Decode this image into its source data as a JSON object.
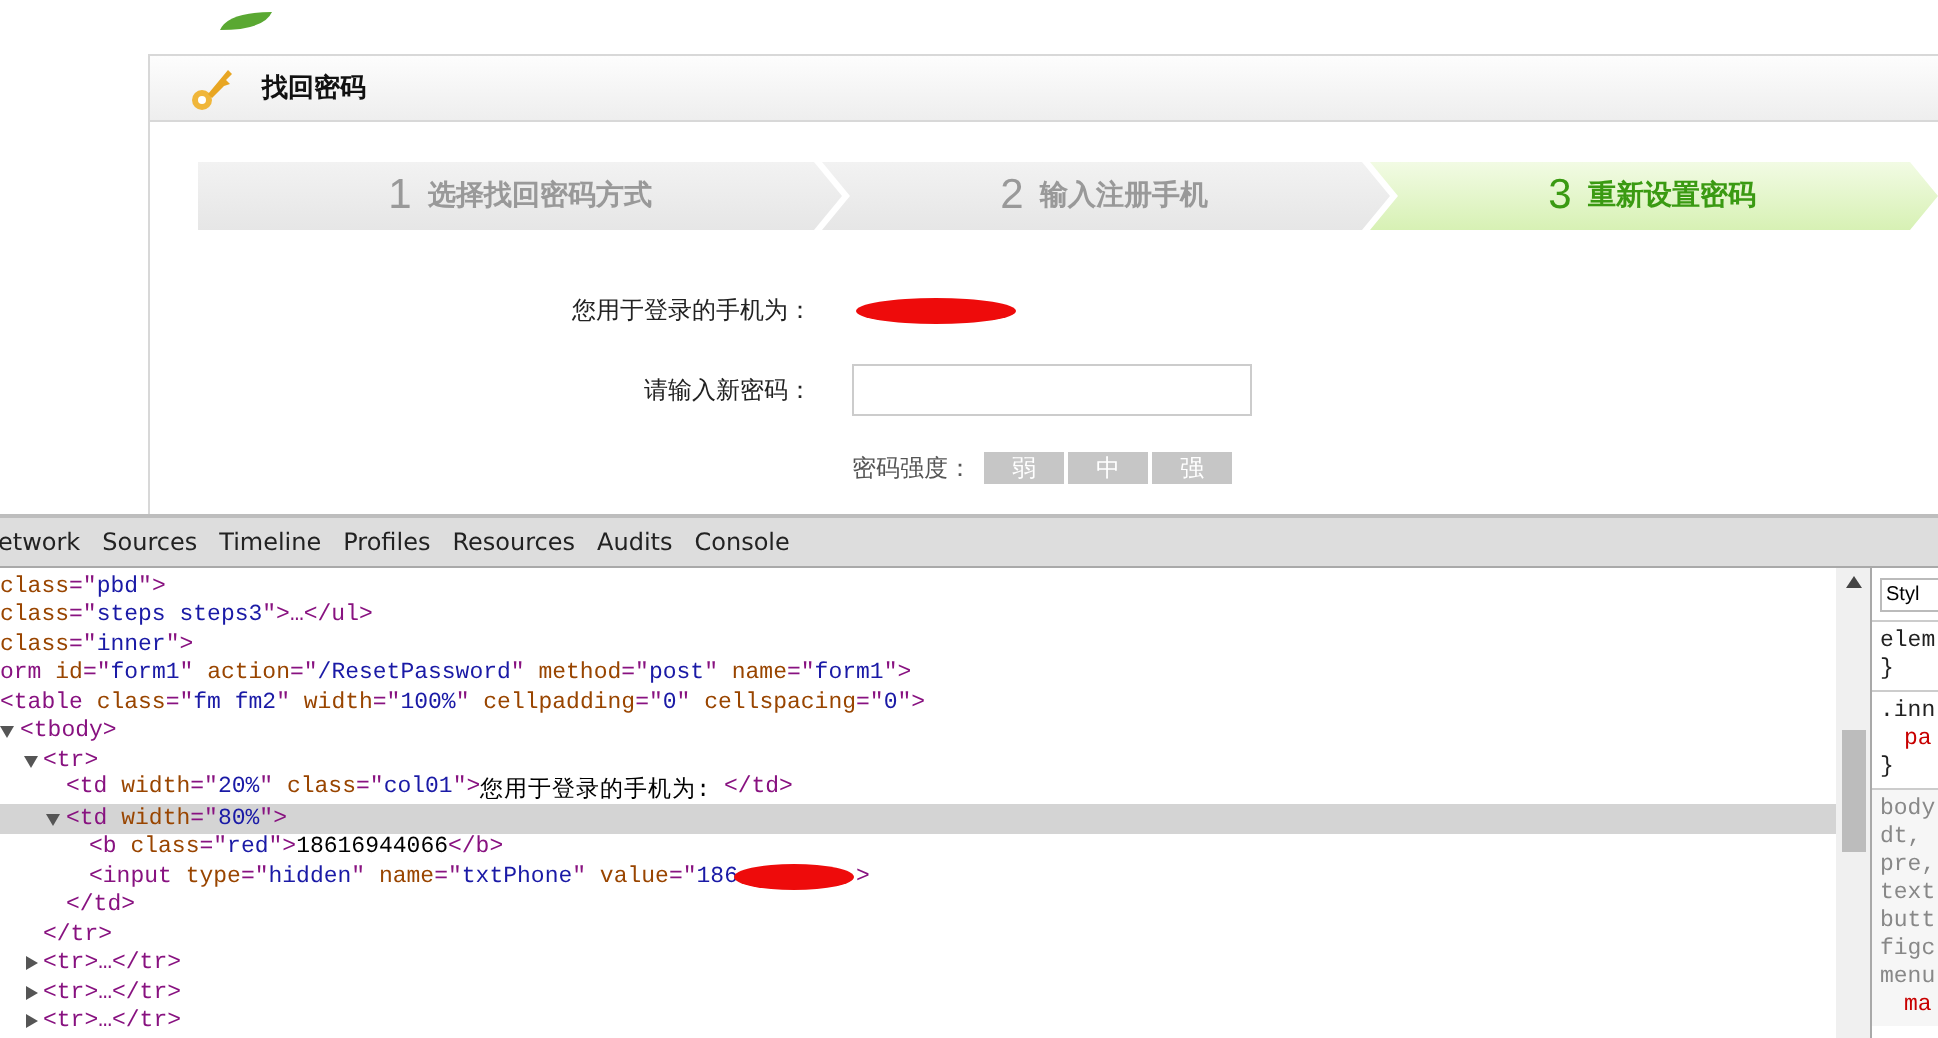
{
  "card": {
    "title": "找回密码"
  },
  "steps": [
    {
      "number": "1",
      "label": "选择找回密码方式",
      "selected": false
    },
    {
      "number": "2",
      "label": "输入注册手机",
      "selected": false
    },
    {
      "number": "3",
      "label": "重新设置密码",
      "selected": true
    }
  ],
  "form": {
    "phone_label": "您用于登录的手机为：",
    "phone_redacted": true,
    "password_label": "请输入新密码：",
    "strength_label": "密码强度：",
    "strength_levels": [
      "弱",
      "中",
      "强"
    ]
  },
  "devtools": {
    "tabs": [
      "etwork",
      "Sources",
      "Timeline",
      "Profiles",
      "Resources",
      "Audits",
      "Console"
    ],
    "dom_tree": [
      {
        "tokens": [
          {
            "kind": "attr",
            "text": "class"
          },
          {
            "kind": "punct",
            "text": "=\""
          },
          {
            "kind": "value",
            "text": "pbd"
          },
          {
            "kind": "punct",
            "text": "\">"
          }
        ],
        "selected": false,
        "children": [
          {
            "tokens": [
              {
                "kind": "attr",
                "text": "class"
              },
              {
                "kind": "punct",
                "text": "=\""
              },
              {
                "kind": "value",
                "text": "steps steps3"
              },
              {
                "kind": "punct",
                "text": "\">…</ul>"
              }
            ],
            "selected": false
          },
          {
            "tokens": [
              {
                "kind": "attr",
                "text": "class"
              },
              {
                "kind": "punct",
                "text": "=\""
              },
              {
                "kind": "value",
                "text": "inner"
              },
              {
                "kind": "punct",
                "text": "\">"
              }
            ],
            "selected": false,
            "children": [
              {
                "tokens": [
                  {
                    "kind": "tag",
                    "text": "orm"
                  },
                  {
                    "kind": "attr",
                    "text": " id"
                  },
                  {
                    "kind": "punct",
                    "text": "=\""
                  },
                  {
                    "kind": "value",
                    "text": "form1"
                  },
                  {
                    "kind": "punct",
                    "text": "\""
                  },
                  {
                    "kind": "attr",
                    "text": " action"
                  },
                  {
                    "kind": "punct",
                    "text": "=\""
                  },
                  {
                    "kind": "value",
                    "text": "/ResetPassword"
                  },
                  {
                    "kind": "punct",
                    "text": "\""
                  },
                  {
                    "kind": "attr",
                    "text": " method"
                  },
                  {
                    "kind": "punct",
                    "text": "=\""
                  },
                  {
                    "kind": "value",
                    "text": "post"
                  },
                  {
                    "kind": "punct",
                    "text": "\""
                  },
                  {
                    "kind": "attr",
                    "text": " name"
                  },
                  {
                    "kind": "punct",
                    "text": "=\""
                  },
                  {
                    "kind": "value",
                    "text": "form1"
                  },
                  {
                    "kind": "punct",
                    "text": "\">"
                  }
                ],
                "selected": false,
                "children": [
                  {
                    "tokens": [
                      {
                        "kind": "tag",
                        "text": "<table"
                      },
                      {
                        "kind": "attr",
                        "text": " class"
                      },
                      {
                        "kind": "punct",
                        "text": "=\""
                      },
                      {
                        "kind": "value",
                        "text": "fm fm2"
                      },
                      {
                        "kind": "punct",
                        "text": "\""
                      },
                      {
                        "kind": "attr",
                        "text": " width"
                      },
                      {
                        "kind": "punct",
                        "text": "=\""
                      },
                      {
                        "kind": "value",
                        "text": "100%"
                      },
                      {
                        "kind": "punct",
                        "text": "\""
                      },
                      {
                        "kind": "attr",
                        "text": " cellpadding"
                      },
                      {
                        "kind": "punct",
                        "text": "=\""
                      },
                      {
                        "kind": "value",
                        "text": "0"
                      },
                      {
                        "kind": "punct",
                        "text": "\""
                      },
                      {
                        "kind": "attr",
                        "text": " cellspacing"
                      },
                      {
                        "kind": "punct",
                        "text": "=\""
                      },
                      {
                        "kind": "value",
                        "text": "0"
                      },
                      {
                        "kind": "punct",
                        "text": "\">"
                      }
                    ],
                    "selected": false,
                    "children": [
                      {
                        "tokens": [
                          {
                            "kind": "tag",
                            "text": "<tbody>"
                          }
                        ],
                        "selected": false,
                        "expanded": true,
                        "children": [
                          {
                            "tokens": [
                              {
                                "kind": "tag",
                                "text": "<tr>"
                              }
                            ],
                            "selected": false,
                            "expanded": true,
                            "children": [
                              {
                                "tokens": [
                                  {
                                    "kind": "tag",
                                    "text": "<td"
                                  },
                                  {
                                    "kind": "attr",
                                    "text": " width"
                                  },
                                  {
                                    "kind": "punct",
                                    "text": "=\""
                                  },
                                  {
                                    "kind": "value",
                                    "text": "20%"
                                  },
                                  {
                                    "kind": "punct",
                                    "text": "\""
                                  },
                                  {
                                    "kind": "attr",
                                    "text": " class"
                                  },
                                  {
                                    "kind": "punct",
                                    "text": "=\""
                                  },
                                  {
                                    "kind": "value",
                                    "text": "col01"
                                  },
                                  {
                                    "kind": "punct",
                                    "text": "\">"
                                  },
                                  {
                                    "kind": "text",
                                    "text": "您用于登录的手机为: "
                                  },
                                  {
                                    "kind": "tag",
                                    "text": "</td>"
                                  }
                                ],
                                "selected": false
                              },
                              {
                                "tokens": [
                                  {
                                    "kind": "tag",
                                    "text": "<td"
                                  },
                                  {
                                    "kind": "attr",
                                    "text": " width"
                                  },
                                  {
                                    "kind": "punct",
                                    "text": "=\""
                                  },
                                  {
                                    "kind": "value",
                                    "text": "80%"
                                  },
                                  {
                                    "kind": "punct",
                                    "text": "\">"
                                  }
                                ],
                                "selected": true,
                                "expanded": true,
                                "children": [
                                  {
                                    "tokens": [
                                      {
                                        "kind": "tag",
                                        "text": "<b"
                                      },
                                      {
                                        "kind": "attr",
                                        "text": " class"
                                      },
                                      {
                                        "kind": "punct",
                                        "text": "=\""
                                      },
                                      {
                                        "kind": "value",
                                        "text": "red"
                                      },
                                      {
                                        "kind": "punct",
                                        "text": "\">"
                                      },
                                      {
                                        "kind": "text",
                                        "text": "18616944066"
                                      },
                                      {
                                        "kind": "tag",
                                        "text": "</b>"
                                      }
                                    ],
                                    "selected": false
                                  },
                                  {
                                    "tokens": [
                                      {
                                        "kind": "tag",
                                        "text": "<input"
                                      },
                                      {
                                        "kind": "attr",
                                        "text": " type"
                                      },
                                      {
                                        "kind": "punct",
                                        "text": "=\""
                                      },
                                      {
                                        "kind": "value",
                                        "text": "hidden"
                                      },
                                      {
                                        "kind": "punct",
                                        "text": "\""
                                      },
                                      {
                                        "kind": "attr",
                                        "text": " name"
                                      },
                                      {
                                        "kind": "punct",
                                        "text": "=\""
                                      },
                                      {
                                        "kind": "value",
                                        "text": "txtPhone"
                                      },
                                      {
                                        "kind": "punct",
                                        "text": "\""
                                      },
                                      {
                                        "kind": "attr",
                                        "text": " value"
                                      },
                                      {
                                        "kind": "punct",
                                        "text": "=\""
                                      },
                                      {
                                        "kind": "value",
                                        "text": "186"
                                      },
                                      {
                                        "kind": "redaction"
                                      },
                                      {
                                        "kind": "punct",
                                        "text": ">"
                                      }
                                    ],
                                    "selected": false
                                  }
                                ],
                                "closing": "</td>"
                              }
                            ],
                            "closing": "</tr>"
                          },
                          {
                            "tokens": [
                              {
                                "kind": "tag",
                                "text": "<tr>…</tr>"
                              }
                            ],
                            "selected": false,
                            "expanded": false
                          },
                          {
                            "tokens": [
                              {
                                "kind": "tag",
                                "text": "<tr>…</tr>"
                              }
                            ],
                            "selected": false,
                            "expanded": false
                          },
                          {
                            "tokens": [
                              {
                                "kind": "tag",
                                "text": "<tr>…</tr>"
                              }
                            ],
                            "selected": false,
                            "expanded": false
                          }
                        ]
                      }
                    ]
                  }
                ]
              }
            ]
          }
        ]
      }
    ],
    "styles_panel": {
      "tab": "Styl",
      "blocks": [
        {
          "kind": "rule",
          "lines": [
            {
              "kind": "selector",
              "text": "elem"
            },
            {
              "kind": "brace",
              "text": "}"
            }
          ]
        },
        {
          "kind": "rule",
          "lines": [
            {
              "kind": "selector",
              "text": ".inn"
            },
            {
              "kind": "property",
              "text": "pa"
            },
            {
              "kind": "brace",
              "text": "}"
            }
          ]
        },
        {
          "kind": "agent",
          "lines": [
            {
              "kind": "selector",
              "text": "body"
            },
            {
              "kind": "selector",
              "text": "dt, "
            },
            {
              "kind": "selector",
              "text": "pre,"
            },
            {
              "kind": "selector",
              "text": "text"
            },
            {
              "kind": "selector",
              "text": "butt"
            },
            {
              "kind": "selector",
              "text": "figc"
            },
            {
              "kind": "selector",
              "text": "menu"
            },
            {
              "kind": "property",
              "text": "ma"
            }
          ]
        }
      ]
    }
  }
}
